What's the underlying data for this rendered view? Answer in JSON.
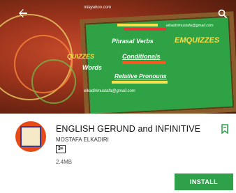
{
  "banner": {
    "email_top": "mlayahoo.com",
    "email_board": "elkadirimustafa@gmail.com",
    "phrasal": "Phrasal Verbs",
    "brand": "EMQUIZZES",
    "conditionals": "Conditionals",
    "quizzes": "QUIZZES",
    "words": "Words",
    "relative": "Relative Pronouns",
    "email_bottom": "elkadirimustafa@gmail.com"
  },
  "app": {
    "title": "ENGLISH GERUND and INFINITIVE",
    "developer": "MOSTAFA ELKADIRI",
    "rating_badge": "3+",
    "size": "2.4MB",
    "install_label": "INSTALL"
  },
  "colors": {
    "accent": "#30a14b",
    "icon_bg": "#e64a19"
  }
}
